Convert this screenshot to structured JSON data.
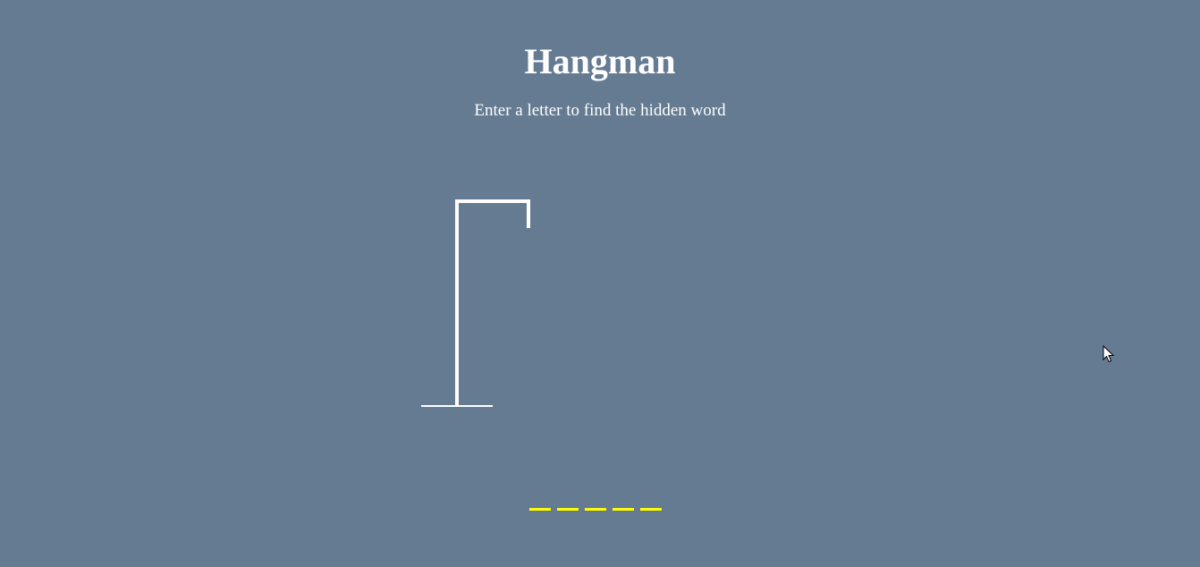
{
  "game": {
    "title": "Hangman",
    "instructions": "Enter a letter to find the hidden word"
  },
  "word": {
    "letters": [
      "",
      "",
      "",
      "",
      ""
    ],
    "underline_color": "#ffff00"
  },
  "colors": {
    "background": "#657b92",
    "text": "#ffffff",
    "gallows": "#ffffff"
  },
  "icons": {
    "cursor": "mouse-pointer-icon"
  }
}
